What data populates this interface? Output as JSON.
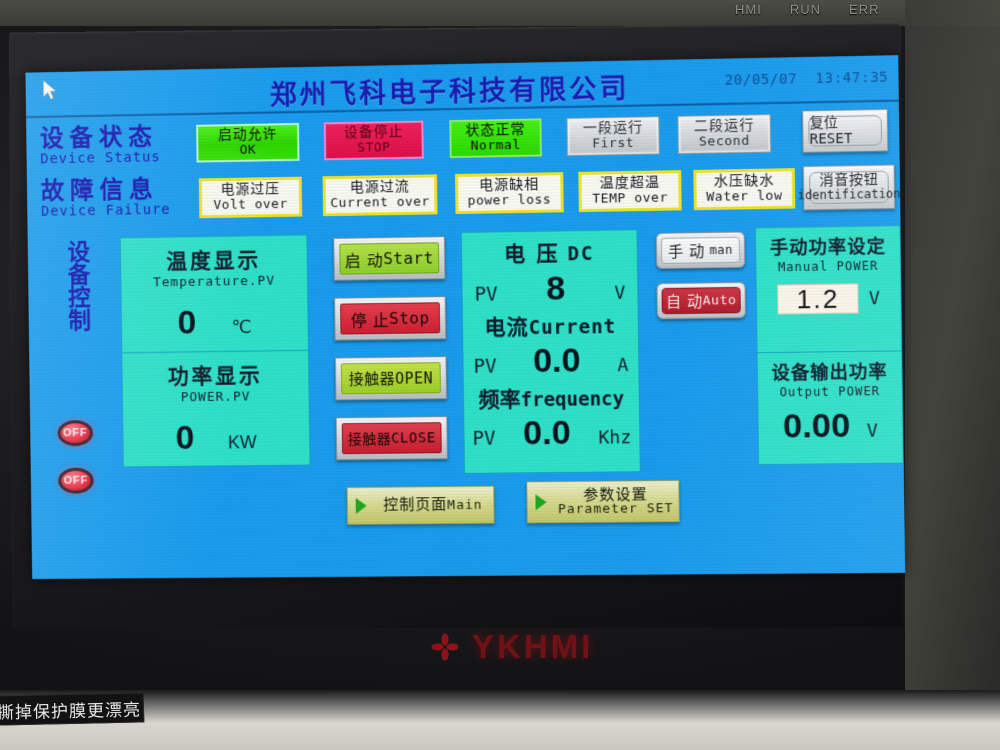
{
  "device": {
    "brand": "YKHMI",
    "bezel_leds": [
      "HMI",
      "RUN",
      "ERR"
    ],
    "sticker_text": "撕掉保护膜更漂亮"
  },
  "screen": {
    "title": "郑州飞科电子科技有限公司",
    "date": "20/05/07",
    "time": "13:47:35",
    "accent_bg": "#1a9ef0",
    "panel_color": "#2fe3cb"
  },
  "status_section": {
    "label_cn": "设备状态",
    "label_en": "Device Status",
    "items": [
      {
        "cn": "启动允许",
        "en": "OK",
        "state": "green"
      },
      {
        "cn": "设备停止",
        "en": "STOP",
        "state": "pink"
      },
      {
        "cn": "状态正常",
        "en": "Normal",
        "state": "green2"
      },
      {
        "cn": "一段运行",
        "en": "First",
        "state": "gray"
      },
      {
        "cn": "二段运行",
        "en": "Second",
        "state": "gray"
      }
    ],
    "reset_button": {
      "cn": "复位",
      "en": "RESET"
    }
  },
  "fault_section": {
    "label_cn": "故障信息",
    "label_en": "Device Failure",
    "items": [
      {
        "cn": "电源过压",
        "en": "Volt over"
      },
      {
        "cn": "电源过流",
        "en": "Current over"
      },
      {
        "cn": "电源缺相",
        "en": "power loss"
      },
      {
        "cn": "温度超温",
        "en": "TEMP over"
      },
      {
        "cn": "水压缺水",
        "en": "Water low"
      }
    ],
    "mute_button": {
      "cn": "消音按钮",
      "en": "identification"
    }
  },
  "control_section": {
    "vertical_label": "设备控制",
    "lamps": [
      {
        "label": "OFF"
      },
      {
        "label": "OFF"
      }
    ]
  },
  "readouts": {
    "temperature": {
      "title_cn": "温度显示",
      "title_en": "Temperature.PV",
      "tag": "",
      "value": "0",
      "unit": "℃"
    },
    "power": {
      "title_cn": "功率显示",
      "title_en": "POWER.PV",
      "tag": "",
      "value": "0",
      "unit": "KW"
    },
    "voltage": {
      "title_cn": "电 压",
      "title_en": "DC",
      "tag": "PV",
      "value": "8",
      "unit": "V"
    },
    "current": {
      "title_cn": "电流",
      "title_en": "Current",
      "tag": "PV",
      "value": "0.0",
      "unit": "A"
    },
    "frequency": {
      "title_cn": "频率",
      "title_en": "frequency",
      "tag": "PV",
      "value": "0.0",
      "unit": "Khz"
    },
    "manual_power": {
      "title_cn": "手动功率设定",
      "title_en": "Manual POWER",
      "value": "1.2",
      "unit": "V"
    },
    "output_power": {
      "title_cn": "设备输出功率",
      "title_en": "Output POWER",
      "value": "0.00",
      "unit": "V"
    }
  },
  "action_buttons": [
    {
      "cn": "启 动",
      "en": "Start",
      "face": "green"
    },
    {
      "cn": "停 止",
      "en": "Stop",
      "face": "red"
    },
    {
      "cn": "接触器",
      "en": "OPEN",
      "face": "ygreen"
    },
    {
      "cn": "接触器",
      "en": "CLOSE",
      "face": "red2"
    }
  ],
  "mode_buttons": [
    {
      "cn": "手 动",
      "en": "man",
      "face": "man"
    },
    {
      "cn": "自 动",
      "en": "Auto",
      "face": "auto"
    }
  ],
  "nav_buttons": [
    {
      "cn": "控制页面",
      "en": "Main"
    },
    {
      "cn": "参数设置",
      "en": "Parameter  SET"
    }
  ]
}
